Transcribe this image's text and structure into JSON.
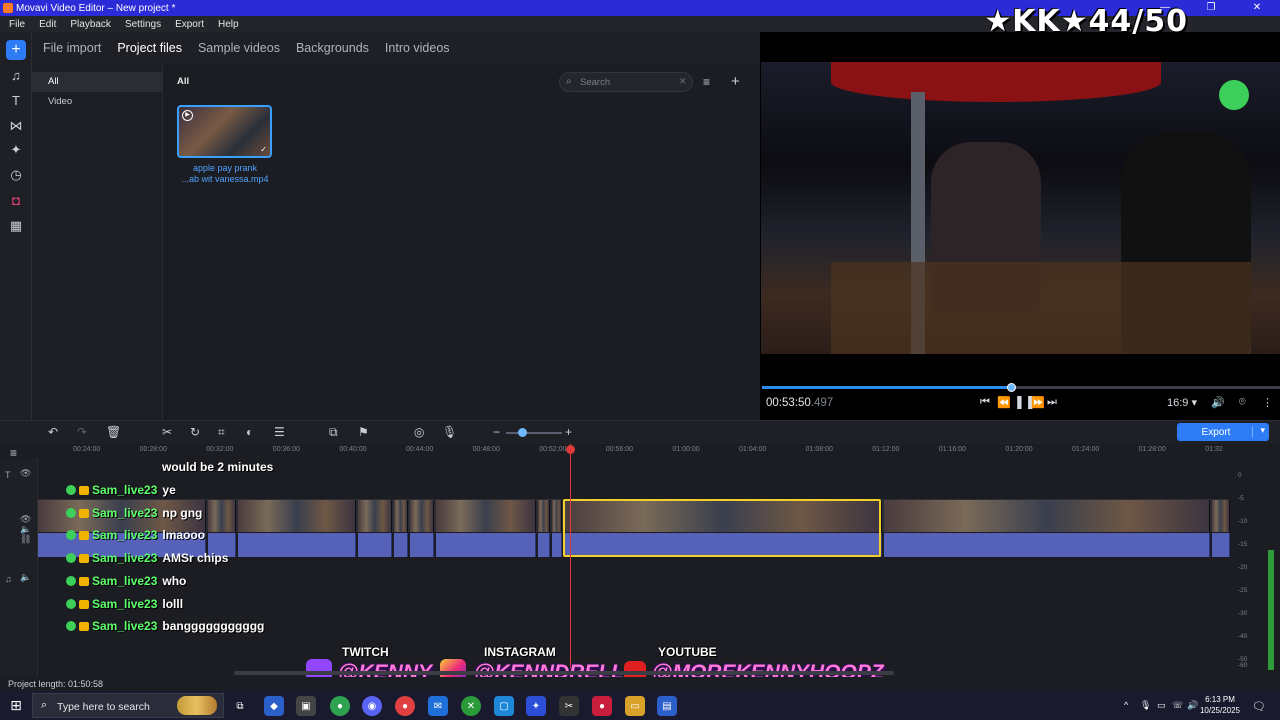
{
  "window": {
    "title": "Movavi Video Editor – New project *",
    "controls": [
      "—",
      "❐",
      "✕"
    ]
  },
  "menu": [
    "File",
    "Edit",
    "Playback",
    "Settings",
    "Export",
    "Help"
  ],
  "overlay_score": "★KK★44/50",
  "tabs": [
    "File import",
    "Project files",
    "Sample videos",
    "Backgrounds",
    "Intro videos"
  ],
  "active_tab": "Project files",
  "categories": [
    "All",
    "Video"
  ],
  "media": {
    "section_title": "All",
    "search_placeholder": "Search",
    "file_caption_line1": "apple pay prank",
    "file_caption_line2": "...ab wit vanessa.mp4"
  },
  "player": {
    "time_main": "00:53:50",
    "time_ms": ".497",
    "aspect": "16:9",
    "progress": 0.48
  },
  "toolbar": {
    "export_label": "Export"
  },
  "ruler_ticks": [
    "00:24:00",
    "00:28:00",
    "00:32:00",
    "00:36:00",
    "00:40:00",
    "00:44:00",
    "00:48:00",
    "00:52:00",
    "00:56:00",
    "01:00:00",
    "01:04:00",
    "01:08:00",
    "01:12:00",
    "01:16:00",
    "01:20:00",
    "01:24:00",
    "01:28:00",
    "01:32"
  ],
  "vu_labels": [
    "0",
    "-5",
    "-10",
    "-15",
    "-20",
    "-25",
    "-30",
    "-40",
    "-50",
    "-60"
  ],
  "chat": {
    "header_message": "would be 2 minutes",
    "lines": [
      {
        "user": "Sam_live23",
        "msg": "ye"
      },
      {
        "user": "Sam_live23",
        "msg": "np gng"
      },
      {
        "user": "Sam_live23",
        "msg": "lmaooo"
      },
      {
        "user": "Sam_live23",
        "msg": "AMSr chips"
      },
      {
        "user": "Sam_live23",
        "msg": "who"
      },
      {
        "user": "Sam_live23",
        "msg": "lolll"
      },
      {
        "user": "Sam_live23",
        "msg": "banggggggggggg"
      }
    ]
  },
  "socials": {
    "twitch_head": "TWITCH",
    "twitch_handle": "@KENNY",
    "instagram_head": "INSTAGRAM",
    "instagram_handle": "@KENNDRELL",
    "youtube_head": "YOUTUBE",
    "youtube_handle": "@MOREKENNYHOOPZ"
  },
  "status": {
    "project_length": "Project length: 01:50:58"
  },
  "taskbar": {
    "search_placeholder": "Type here to search",
    "time": "6:13 PM",
    "date": "10/25/2025"
  },
  "colors": {
    "accent": "#2d7cf6",
    "selection": "#f1d02b",
    "playhead": "#e03a3a",
    "audio_clip": "#5562b8"
  }
}
